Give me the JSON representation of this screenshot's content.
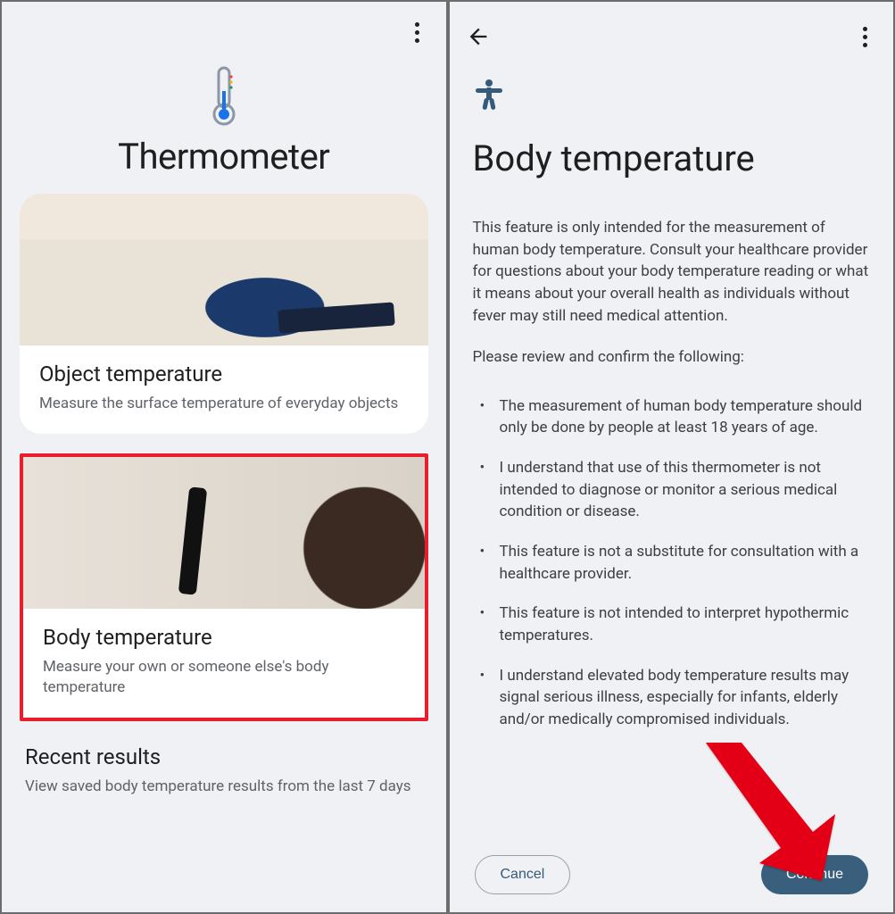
{
  "left": {
    "title": "Thermometer",
    "cards": [
      {
        "title": "Object temperature",
        "desc": "Measure the surface temperature of everyday objects"
      },
      {
        "title": "Body temperature",
        "desc": "Measure your own or someone else's body temperature"
      },
      {
        "title": "Recent results",
        "desc": "View saved body temperature results from the last 7 days"
      }
    ]
  },
  "right": {
    "title": "Body temperature",
    "intro": "This feature is only intended for the measurement of human body temperature. Consult your healthcare provider for questions about your body temperature reading or what it means about your overall health as individuals without fever may still need medical attention.",
    "review_prompt": "Please review and confirm the following:",
    "terms": [
      "The measurement of human body temperature should only be done by people at least 18 years of age.",
      "I understand that use of this thermometer is not intended to diagnose or monitor a serious medical condition or disease.",
      "This feature is not a substitute for consultation with a healthcare provider.",
      "This feature is not intended to interpret hypothermic temperatures.",
      "I understand elevated body temperature results may signal serious illness, especially for infants, elderly and/or medically compromised individuals."
    ],
    "buttons": {
      "cancel": "Cancel",
      "continue": "Continue"
    }
  },
  "colors": {
    "accent": "#3a5f7d",
    "highlight": "#ea1d2c"
  }
}
